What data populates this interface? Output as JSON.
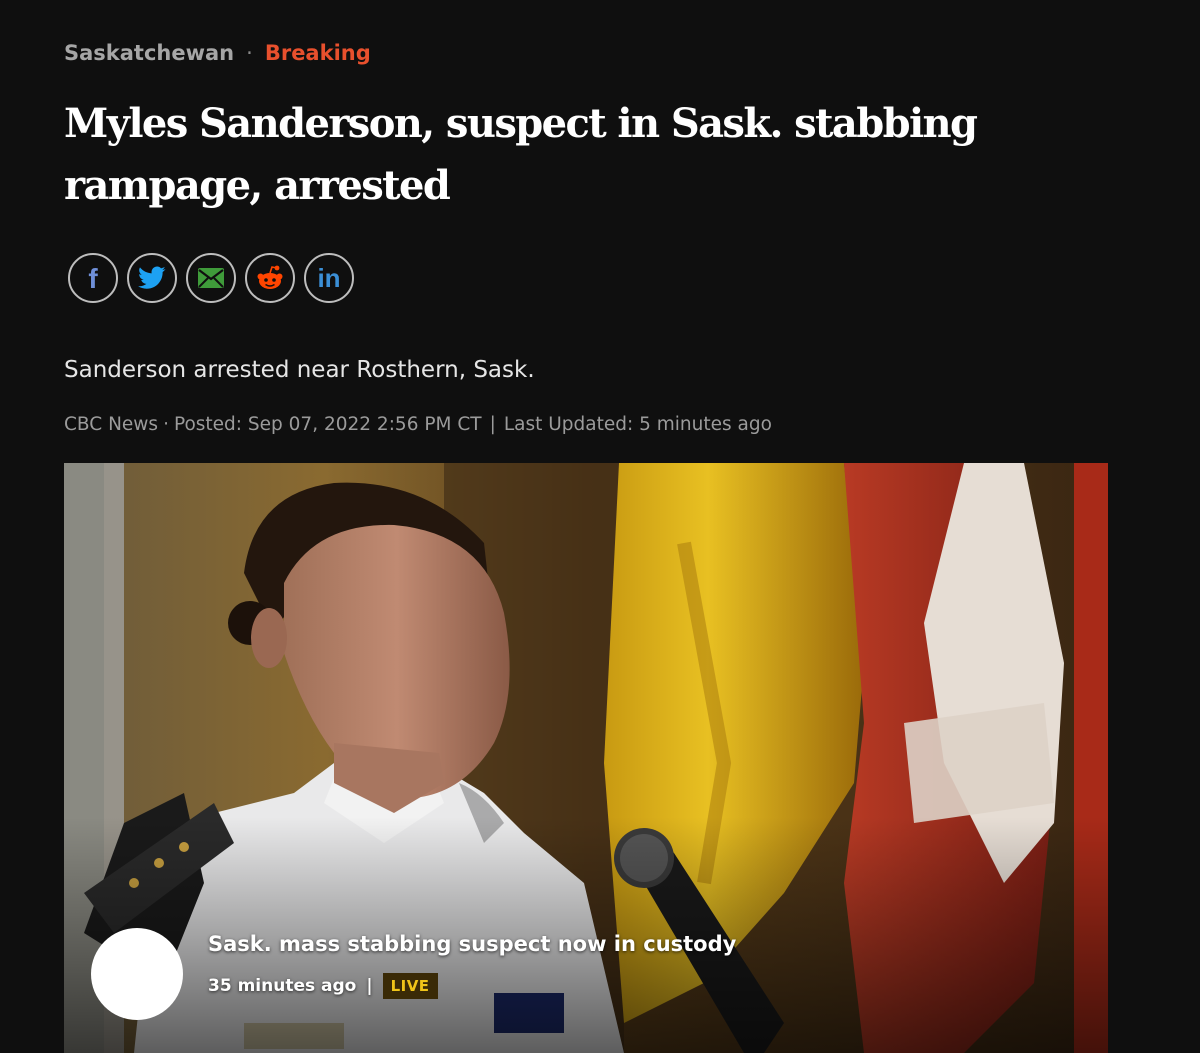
{
  "breadcrumb": {
    "section": "Saskatchewan",
    "separator": "·",
    "tag": "Breaking"
  },
  "headline": "Myles Sanderson, suspect in Sask. stabbing rampage, arrested",
  "share": [
    {
      "label": "f",
      "icon": "facebook-icon",
      "color": "#6f8fd8"
    },
    {
      "icon": "twitter-icon",
      "color": "#1da1f2"
    },
    {
      "icon": "email-icon",
      "color": "#3f9b3a"
    },
    {
      "icon": "reddit-icon",
      "color": "#ff4500"
    },
    {
      "label": "in",
      "icon": "linkedin-icon",
      "color": "#3b8fd6"
    }
  ],
  "deck": "Sanderson arrested near Rosthern, Sask.",
  "byline": {
    "source": "CBC News",
    "dot": "·",
    "posted": "Posted: Sep 07, 2022 2:56 PM CT",
    "pipe": "|",
    "updated": "Last Updated: 5 minutes ago"
  },
  "live": {
    "title": "Sask. mass stabbing suspect now in custody",
    "time": "35 minutes ago",
    "pipe": "|",
    "badge": "LIVE"
  },
  "colors": {
    "background": "#0f0f0f",
    "breaking": "#e8502d",
    "live_badge_text": "#f0c419"
  }
}
